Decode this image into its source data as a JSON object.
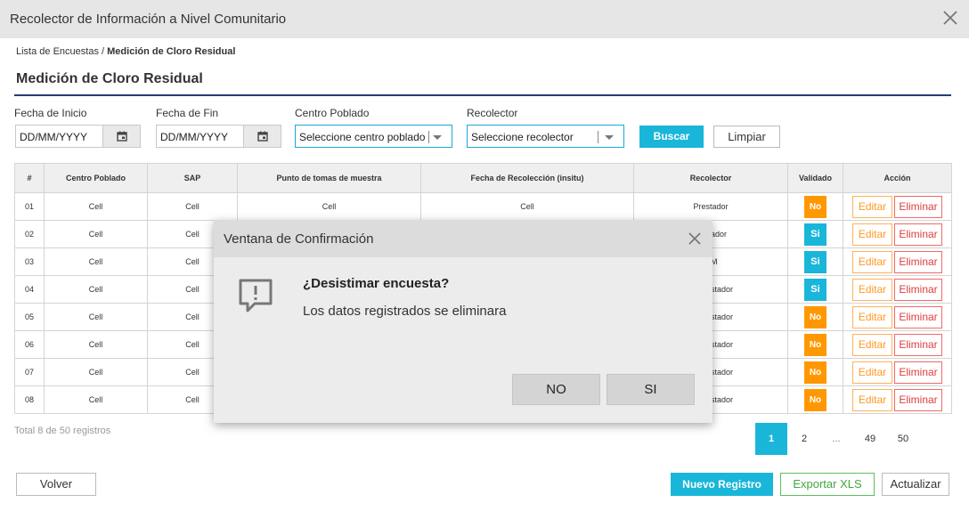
{
  "window": {
    "title": "Recolector de Información a Nivel Comunitario"
  },
  "breadcrumb": {
    "parent": "Lista de Encuestas",
    "separator": "/",
    "current": "Medición de Cloro Residual"
  },
  "page_title": "Medición de Cloro Residual",
  "filters": {
    "fecha_inicio": {
      "label": "Fecha de Inicio",
      "value": "DD/MM/YYYY"
    },
    "fecha_fin": {
      "label": "Fecha de Fin",
      "value": "DD/MM/YYYY"
    },
    "centro_poblado": {
      "label": "Centro Poblado",
      "value": "Seleccione centro poblado"
    },
    "recolector": {
      "label": "Recolector",
      "value": "Seleccione recolector"
    },
    "buscar_label": "Buscar",
    "limpiar_label": "Limpiar"
  },
  "table": {
    "headers": [
      "#",
      "Centro Poblado",
      "SAP",
      "Punto de tomas de muestra",
      "Fecha de Recolección (insitu)",
      "Recolector",
      "Validado",
      "Acción"
    ],
    "rows": [
      {
        "num": "01",
        "centro": "Cell",
        "sap": "Cell",
        "punto": "Cell",
        "fecha": "Cell",
        "recolector": "Prestador",
        "validado": "No"
      },
      {
        "num": "02",
        "centro": "Cell",
        "sap": "Cell",
        "punto": "",
        "fecha": "",
        "recolector": "ador",
        "validado": "Si"
      },
      {
        "num": "03",
        "centro": "Cell",
        "sap": "Cell",
        "punto": "",
        "fecha": "",
        "recolector": "M",
        "validado": "Si"
      },
      {
        "num": "04",
        "centro": "Cell",
        "sap": "Cell",
        "punto": "",
        "fecha": "",
        "recolector": "stador",
        "validado": "Si"
      },
      {
        "num": "05",
        "centro": "Cell",
        "sap": "Cell",
        "punto": "",
        "fecha": "",
        "recolector": "stador",
        "validado": "No"
      },
      {
        "num": "06",
        "centro": "Cell",
        "sap": "Cell",
        "punto": "",
        "fecha": "",
        "recolector": "stador",
        "validado": "No"
      },
      {
        "num": "07",
        "centro": "Cell",
        "sap": "Cell",
        "punto": "",
        "fecha": "",
        "recolector": "stador",
        "validado": "No"
      },
      {
        "num": "08",
        "centro": "Cell",
        "sap": "Cell",
        "punto": "",
        "fecha": "",
        "recolector": "stador",
        "validado": "No"
      }
    ],
    "edit_label": "Editar",
    "delete_label": "Eliminar"
  },
  "total_text": "Total 8 de 50 registros",
  "pagination": {
    "pages": [
      "1",
      "2",
      "...",
      "49",
      "50"
    ],
    "active": "1"
  },
  "footer": {
    "volver_label": "Volver",
    "nuevo_label": "Nuevo Registro",
    "exportar_label": "Exportar XLS",
    "actualizar_label": "Actualizar"
  },
  "modal": {
    "title": "Ventana de Confirmación",
    "question": "¿Desistimar encuesta?",
    "message": "Los datos registrados se eliminara",
    "no_label": "NO",
    "si_label": "SI"
  },
  "colors": {
    "accent": "#1ab6d9",
    "warning": "#ff9800",
    "danger": "#e03d3d",
    "success": "#3fa83f",
    "title_rule": "#283b7a"
  },
  "icons": {
    "close": "close-icon",
    "calendar": "calendar-icon",
    "dropdown": "chevron-down-icon",
    "alert": "message-alert-icon"
  }
}
